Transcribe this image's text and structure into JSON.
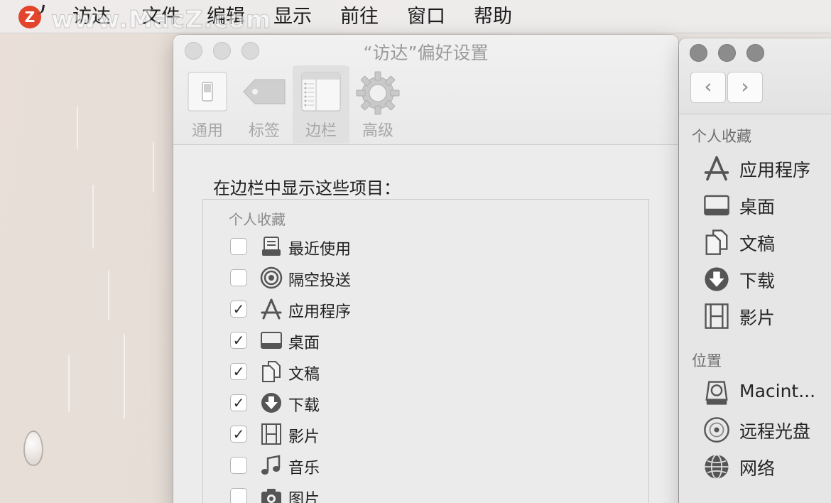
{
  "menubar": {
    "watermark": "www.MacZ.com",
    "items": [
      "访达",
      "文件",
      "编辑",
      "显示",
      "前往",
      "窗口",
      "帮助"
    ]
  },
  "prefs": {
    "title": "“访达”偏好设置",
    "tabs": [
      {
        "label": "通用",
        "icon": "switch-icon"
      },
      {
        "label": "标签",
        "icon": "tag-icon"
      },
      {
        "label": "边栏",
        "icon": "sidebar-icon",
        "active": true
      },
      {
        "label": "高级",
        "icon": "gear-icon"
      }
    ],
    "heading": "在边栏中显示这些项目：",
    "group": "个人收藏",
    "rows": [
      {
        "label": "最近使用",
        "checked": false,
        "icon": "recents-icon"
      },
      {
        "label": "隔空投送",
        "checked": false,
        "icon": "airdrop-icon"
      },
      {
        "label": "应用程序",
        "checked": true,
        "icon": "applications-icon"
      },
      {
        "label": "桌面",
        "checked": true,
        "icon": "desktop-icon"
      },
      {
        "label": "文稿",
        "checked": true,
        "icon": "documents-icon"
      },
      {
        "label": "下载",
        "checked": true,
        "icon": "downloads-icon"
      },
      {
        "label": "影片",
        "checked": true,
        "icon": "movies-icon"
      },
      {
        "label": "音乐",
        "checked": false,
        "icon": "music-icon"
      },
      {
        "label": "图片",
        "checked": false,
        "icon": "pictures-icon"
      }
    ],
    "checkmark": "✓"
  },
  "finder": {
    "back": "‹",
    "forward": "›",
    "favorites_title": "个人收藏",
    "favorites": [
      {
        "label": "应用程序",
        "icon": "applications-icon"
      },
      {
        "label": "桌面",
        "icon": "desktop-icon"
      },
      {
        "label": "文稿",
        "icon": "documents-icon"
      },
      {
        "label": "下载",
        "icon": "downloads-icon"
      },
      {
        "label": "影片",
        "icon": "movies-icon"
      }
    ],
    "locations_title": "位置",
    "locations": [
      {
        "label": "Macint...",
        "icon": "hard-disk-icon"
      },
      {
        "label": "远程光盘",
        "icon": "remote-disc-icon"
      },
      {
        "label": "网络",
        "icon": "network-icon"
      }
    ]
  }
}
